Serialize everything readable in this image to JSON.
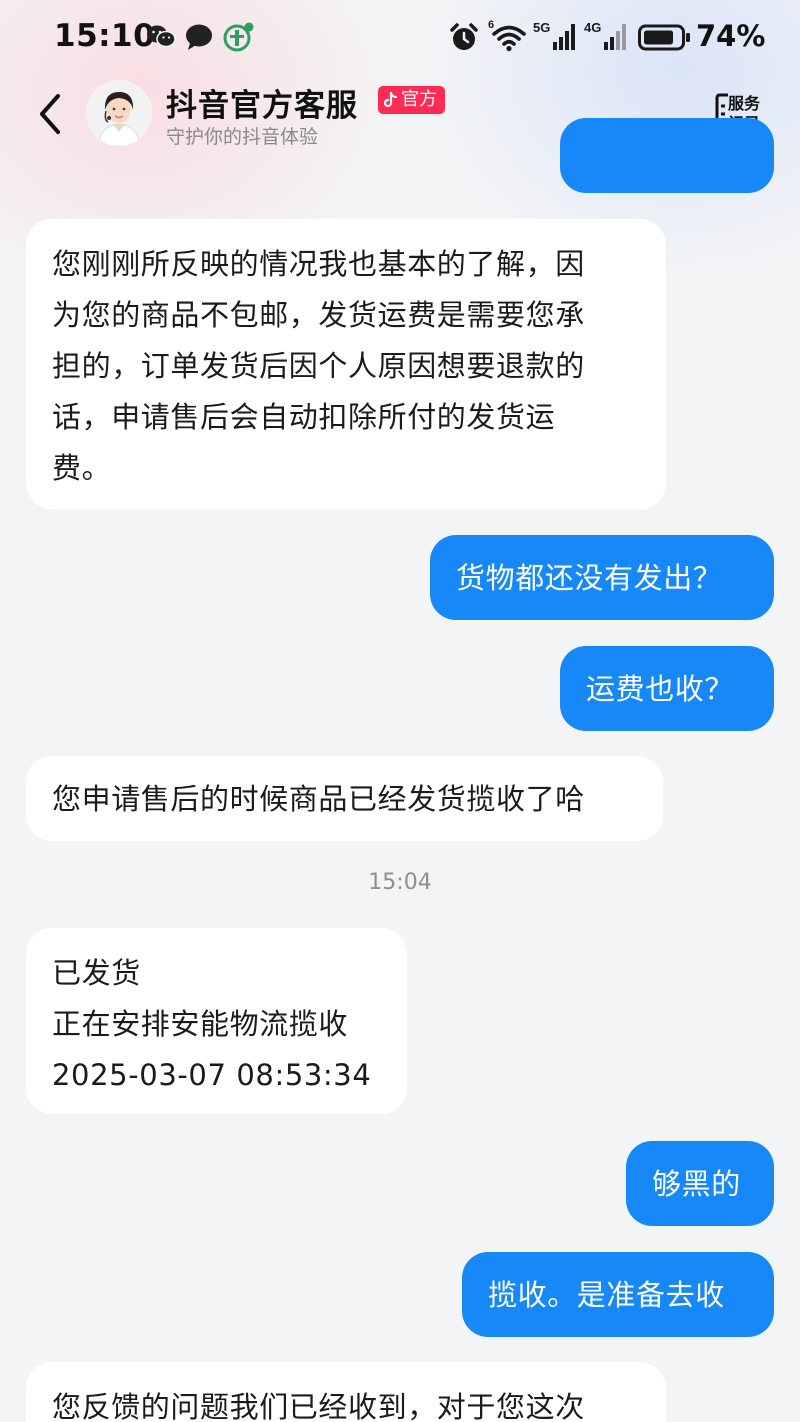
{
  "status_bar": {
    "time": "15:10",
    "network_5g": "5G",
    "network_4g": "4G",
    "wifi_label": "6",
    "battery": "74%"
  },
  "header": {
    "title": "抖音官方客服",
    "badge": "官方",
    "subtitle": "守护你的抖音体验",
    "service_record_line1": "服务",
    "service_record_line2": "记录"
  },
  "colors": {
    "outgoing_bubble": "#1688f8",
    "incoming_bubble": "#ffffff",
    "badge": "#fe2c55",
    "background": "#f3f4f6"
  },
  "messages": [
    {
      "from": "agent",
      "lines": [
        "您刚刚所反映的情况我也基本的了解，因",
        "为您的商品不包邮，发货运费是需要您承",
        "担的，订单发货后因个人原因想要退款的",
        "话，申请售后会自动扣除所付的发货运",
        "费。"
      ]
    },
    {
      "from": "user",
      "lines": [
        "货物都还没有发出？"
      ]
    },
    {
      "from": "user",
      "lines": [
        "运费也收？"
      ]
    },
    {
      "from": "agent",
      "lines": [
        "您申请售后的时候商品已经发货揽收了哈"
      ]
    },
    {
      "timestamp": "15:04"
    },
    {
      "from": "agent",
      "lines": [
        "已发货",
        "正在安排安能物流揽收",
        "2025-03-07 08:53:34"
      ]
    },
    {
      "from": "user",
      "lines": [
        "够黑的"
      ]
    },
    {
      "from": "user",
      "lines": [
        "揽收。是准备去收"
      ]
    },
    {
      "from": "agent",
      "lines": [
        "您反馈的问题我们已经收到，对于您这次"
      ]
    }
  ]
}
